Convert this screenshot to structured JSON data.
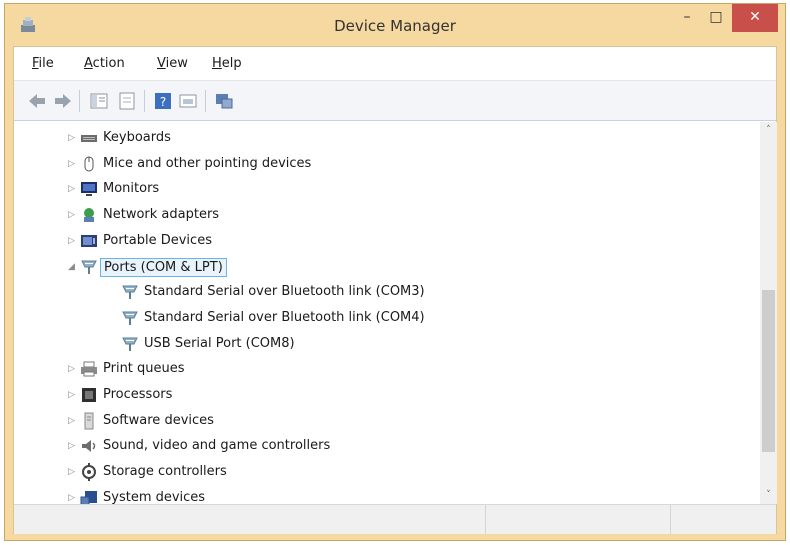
{
  "window": {
    "title": "Device Manager"
  },
  "menu": [
    {
      "accel": "F",
      "rest": "ile"
    },
    {
      "accel": "A",
      "rest": "ction"
    },
    {
      "accel": "V",
      "rest": "iew"
    },
    {
      "accel": "H",
      "rest": "elp"
    }
  ],
  "toolbar": {
    "buttons": [
      "back-arrow-icon",
      "forward-arrow-icon",
      "show-hide-tree-icon",
      "properties-icon",
      "help-icon",
      "update-driver-icon",
      "scan-hardware-icon"
    ]
  },
  "tree": {
    "items": [
      {
        "label": "Keyboards",
        "icon": "keyboard-icon",
        "expander": "▷"
      },
      {
        "label": "Mice and other pointing devices",
        "icon": "mouse-icon",
        "expander": "▷"
      },
      {
        "label": "Monitors",
        "icon": "monitor-icon",
        "expander": "▷"
      },
      {
        "label": "Network adapters",
        "icon": "network-adapter-icon",
        "expander": "▷"
      },
      {
        "label": "Portable Devices",
        "icon": "portable-device-icon",
        "expander": "▷"
      },
      {
        "label": "Ports (COM & LPT)",
        "icon": "port-icon",
        "expander": "◢",
        "selected": true
      },
      {
        "label": "Standard Serial over Bluetooth link (COM3)",
        "icon": "port-icon",
        "child": true
      },
      {
        "label": "Standard Serial over Bluetooth link (COM4)",
        "icon": "port-icon",
        "child": true
      },
      {
        "label": "USB Serial Port (COM8)",
        "icon": "port-icon",
        "child": true
      },
      {
        "label": "Print queues",
        "icon": "printer-icon",
        "expander": "▷"
      },
      {
        "label": "Processors",
        "icon": "processor-icon",
        "expander": "▷"
      },
      {
        "label": "Software devices",
        "icon": "software-device-icon",
        "expander": "▷"
      },
      {
        "label": "Sound, video and game controllers",
        "icon": "speaker-icon",
        "expander": "▷"
      },
      {
        "label": "Storage controllers",
        "icon": "storage-controller-icon",
        "expander": "▷"
      },
      {
        "label": "System devices",
        "icon": "system-device-icon",
        "expander": "▷"
      }
    ]
  },
  "scrollbar": {
    "up": "˄",
    "down": "˅"
  },
  "controls": {
    "minimize": "–",
    "maximize": "□",
    "close": "✕"
  },
  "colors": {
    "title_bar": "#f5d9a0",
    "close_button": "#c9504a",
    "selection_border": "#6db3e8"
  }
}
